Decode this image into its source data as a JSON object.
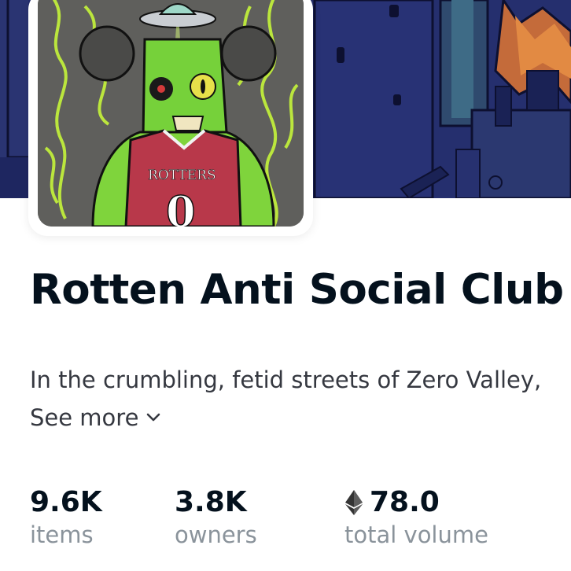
{
  "collection": {
    "name": "Rotten Anti Social Club",
    "description": "In the crumbling, fetid streets of Zero Valley,",
    "see_more_label": "See more",
    "avatar_jersey_text": "ROTTERS",
    "avatar_jersey_number": "0"
  },
  "stats": [
    {
      "value": "9.6K",
      "label": "items"
    },
    {
      "value": "3.8K",
      "label": "owners"
    },
    {
      "value": "78.0",
      "label": "total volume",
      "icon": "ethereum-icon"
    }
  ],
  "colors": {
    "banner_navy": "#252f6e",
    "title_text": "#04111d",
    "muted_text": "#8a939b",
    "glow_green": "#c6f53a"
  }
}
